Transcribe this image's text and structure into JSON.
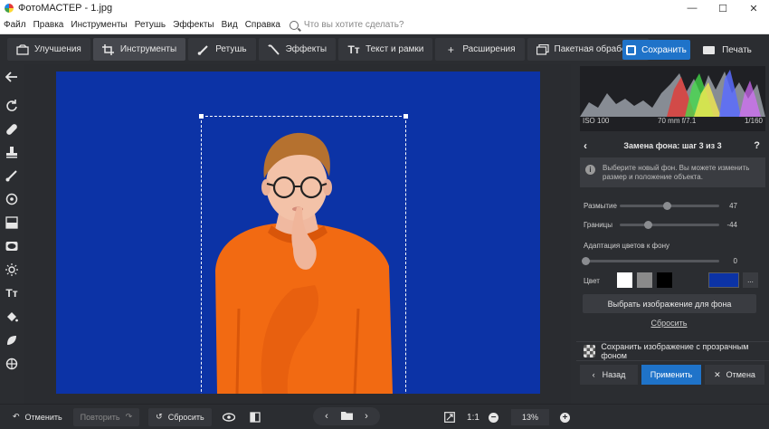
{
  "window": {
    "title": "ФотоМАСТЕР - 1.jpg",
    "minimize": "—",
    "maximize": "☐",
    "close": "✕"
  },
  "menu": {
    "items": [
      "Файл",
      "Правка",
      "Инструменты",
      "Ретушь",
      "Эффекты",
      "Вид",
      "Справка"
    ],
    "search_placeholder": "Что вы хотите сделать?"
  },
  "toolbar": {
    "tabs": [
      {
        "label": "Улучшения",
        "icon": "enhance-icon"
      },
      {
        "label": "Инструменты",
        "icon": "crop-icon",
        "active": true
      },
      {
        "label": "Ретушь",
        "icon": "brush-icon"
      },
      {
        "label": "Эффекты",
        "icon": "magic-wand-icon"
      },
      {
        "label": "Текст и рамки",
        "icon": "text-icon"
      },
      {
        "label": "Расширения",
        "icon": "plus-icon"
      },
      {
        "label": "Пакетная обработка",
        "icon": "batch-icon"
      }
    ],
    "save_label": "Сохранить",
    "print_label": "Печать"
  },
  "photo": {
    "background_color": "#0c33a6",
    "sweater_color": "#f26a12"
  },
  "histogram": {
    "iso": "ISO 100",
    "lens": "70 mm f/7.1",
    "shutter": "1/160"
  },
  "panel": {
    "step_title": "Замена фона: шаг 3 из 3",
    "help": "?",
    "info_text": "Выберите новый фон. Вы можете изменить размер и положение объекта.",
    "sliders": [
      {
        "label": "Размытие",
        "value": "47",
        "fraction": 0.47
      },
      {
        "label": "Границы",
        "value": "-44",
        "fraction": 0.28
      },
      {
        "label": "Адаптация цветов к фону",
        "value": "0",
        "fraction": 0.0
      }
    ],
    "color_label": "Цвет",
    "swatches": [
      "#ffffff",
      "#8a8a8a",
      "#000000"
    ],
    "selected_color": "#0c33a6",
    "more_label": "...",
    "choose_image_label": "Выбрать изображение для фона",
    "reset_label": "Сбросить",
    "save_transparent_label": "Сохранить изображение с прозрачным фоном",
    "back_label": "Назад",
    "apply_label": "Применить",
    "cancel_label": "Отмена"
  },
  "statusbar": {
    "undo_label": "Отменить",
    "redo_label": "Повторить",
    "reset_label": "Сбросить",
    "zoom_1to1": "1:1",
    "zoom_value": "13%"
  }
}
